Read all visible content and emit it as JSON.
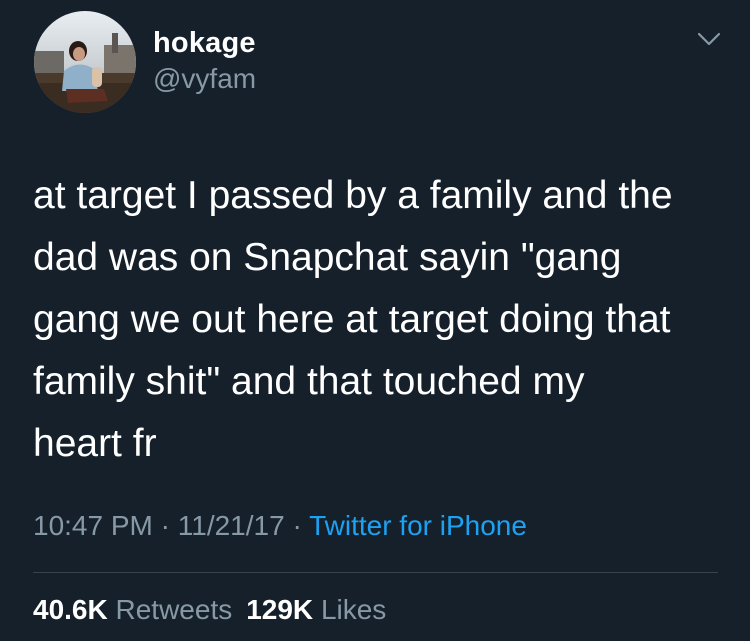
{
  "user": {
    "name": "hokage",
    "handle": "@vyfam"
  },
  "tweet": {
    "text": "at target I passed by a family and the\ndad was on Snapchat sayin \"gang\ngang we out here at target doing that\nfamily shit\" and that touched my\nheart fr"
  },
  "meta": {
    "time": "10:47 PM",
    "date": "11/21/17",
    "separator": "·",
    "source": "Twitter for iPhone"
  },
  "stats": {
    "retweets_count": "40.6K",
    "retweets_label": "Retweets",
    "likes_count": "129K",
    "likes_label": "Likes"
  },
  "icons": {
    "menu": "chevron-down-icon"
  },
  "colors": {
    "background": "#15202b",
    "secondary_text": "#8899a6",
    "link": "#1da1f2",
    "divider": "#38444d"
  }
}
